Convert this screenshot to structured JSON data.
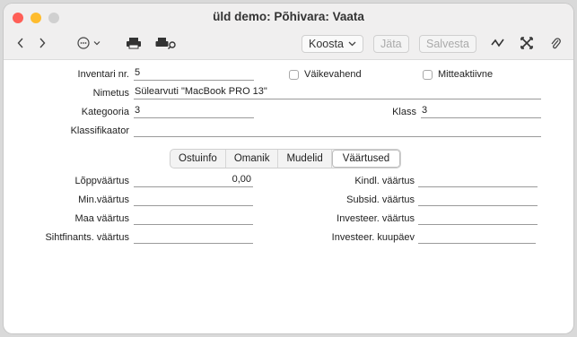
{
  "window": {
    "title": "üld demo: Põhivara: Vaata"
  },
  "colors": {
    "close": "#ff5f57",
    "minimize": "#febc2e",
    "zoom": "#d0d0d0"
  },
  "toolbar": {
    "back_icon": "chevron-left-icon",
    "forward_icon": "chevron-right-icon",
    "more_icon": "ellipsis-circle-icon",
    "print_icon": "printer-icon",
    "print_setup_icon": "printer-search-icon",
    "koosta_label": "Koosta",
    "jata_label": "Jäta",
    "salvesta_label": "Salvesta",
    "activity_icon": "activity-icon",
    "link_icon": "link-icon",
    "attach_icon": "paperclip-icon"
  },
  "form": {
    "inventari_label": "Inventari nr.",
    "inventari_value": "5",
    "vaikevahend_label": "Väikevahend",
    "mitteaktiivne_label": "Mitteaktiivne",
    "nimetus_label": "Nimetus",
    "nimetus_value": "Sülearvuti \"MacBook PRO 13\"",
    "kategooria_label": "Kategooria",
    "kategooria_value": "3",
    "klass_label": "Klass",
    "klass_value": "3",
    "klassifikaator_label": "Klassifikaator",
    "klassifikaator_value": ""
  },
  "tabs": [
    "Ostuinfo",
    "Omanik",
    "Mudelid",
    "Väärtused"
  ],
  "values": {
    "loppvaartus_label": "Lõppväärtus",
    "loppvaartus_value": "0,00",
    "minvaartus_label": "Min.väärtus",
    "minvaartus_value": "",
    "maavaartus_label": "Maa väärtus",
    "maavaartus_value": "",
    "sihtfinants_label": "Sihtfinants. väärtus",
    "sihtfinants_value": "",
    "kindl_label": "Kindl. väärtus",
    "kindl_value": "",
    "subsid_label": "Subsid. väärtus",
    "subsid_value": "",
    "investeer_label": "Investeer. väärtus",
    "investeer_value": "",
    "investeer_kuupaev_label": "Investeer. kuupäev",
    "investeer_kuupaev_value": ""
  }
}
